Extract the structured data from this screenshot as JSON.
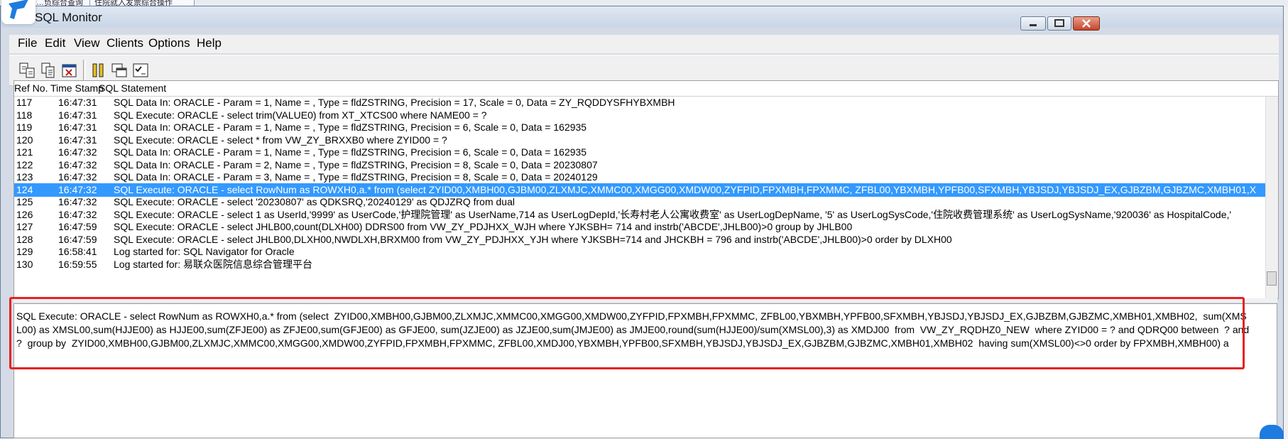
{
  "background_tabs": [
    "…负综合查询",
    "住院就入发票综合操作"
  ],
  "window": {
    "title": "SQL Monitor",
    "accent_color": "#3399ff",
    "highlight_color": "#e62222"
  },
  "menu": [
    {
      "label": "File"
    },
    {
      "label": "Edit"
    },
    {
      "label": "View"
    },
    {
      "label": "Clients"
    },
    {
      "label": "Options"
    },
    {
      "label": "Help"
    }
  ],
  "toolbar": {
    "buttons": [
      "save-log-icon",
      "copy-icon",
      "clear-icon",
      "pause-icon",
      "window-icon",
      "checklist-icon"
    ]
  },
  "list": {
    "columns": [
      "Ref No.",
      "Time Stamp",
      "SQL Statement"
    ],
    "selected_ref": "124",
    "rows": [
      {
        "ref": "117",
        "time": "16:47:31",
        "sql": "SQL Data In: ORACLE - Param = 1, Name = , Type = fldZSTRING, Precision = 17, Scale = 0, Data = ZY_RQDDYSFHYBXMBH"
      },
      {
        "ref": "118",
        "time": "16:47:31",
        "sql": "SQL Execute: ORACLE - select trim(VALUE0) from XT_XTCS00 where NAME00 = ?"
      },
      {
        "ref": "119",
        "time": "16:47:31",
        "sql": "SQL Data In: ORACLE - Param = 1, Name = , Type = fldZSTRING, Precision = 6, Scale = 0, Data = 162935"
      },
      {
        "ref": "120",
        "time": "16:47:31",
        "sql": "SQL Execute: ORACLE - select * from VW_ZY_BRXXB0 where ZYID00 = ?"
      },
      {
        "ref": "121",
        "time": "16:47:32",
        "sql": "SQL Data In: ORACLE - Param = 1, Name = , Type = fldZSTRING, Precision = 6, Scale = 0, Data = 162935"
      },
      {
        "ref": "122",
        "time": "16:47:32",
        "sql": "SQL Data In: ORACLE - Param = 2, Name = , Type = fldZSTRING, Precision = 8, Scale = 0, Data = 20230807"
      },
      {
        "ref": "123",
        "time": "16:47:32",
        "sql": "SQL Data In: ORACLE - Param = 3, Name = , Type = fldZSTRING, Precision = 8, Scale = 0, Data = 20240129"
      },
      {
        "ref": "124",
        "time": "16:47:32",
        "sql": "SQL Execute: ORACLE - select RowNum as ROWXH0,a.* from (select  ZYID00,XMBH00,GJBM00,ZLXMJC,XMMC00,XMGG00,XMDW00,ZYFPID,FPXMBH,FPXMMC, ZFBL00,YBXMBH,YPFB00,SFXMBH,YBJSDJ,YBJSDJ_EX,GJBZBM,GJBZMC,XMBH01,X"
      },
      {
        "ref": "125",
        "time": "16:47:32",
        "sql": "SQL Execute: ORACLE - select '20230807' as QDKSRQ,'20240129' as QDJZRQ from dual"
      },
      {
        "ref": "126",
        "time": "16:47:32",
        "sql": "SQL Execute: ORACLE - select 1 as UserId,'9999' as UserCode,'护理院管理' as UserName,714 as UserLogDepId,'长寿村老人公寓收费室' as UserLogDepName, '5' as UserLogSysCode,'住院收费管理系统' as UserLogSysName,'920036' as HospitalCode,'"
      },
      {
        "ref": "127",
        "time": "16:47:59",
        "sql": "SQL Execute: ORACLE - select JHLB00,count(DLXH00) DDRS00 from VW_ZY_PDJHXX_WJH    where YJKSBH= 714 and instrb('ABCDE',JHLB00)>0 group by JHLB00"
      },
      {
        "ref": "128",
        "time": "16:47:59",
        "sql": "SQL Execute: ORACLE - select JHLB00,DLXH00,NWDLXH,BRXM00 from VW_ZY_PDJHXX_YJH    where YJKSBH=714 and JHCKBH = 796 and instrb('ABCDE',JHLB00)>0 order by DLXH00"
      },
      {
        "ref": "129",
        "time": "16:58:41",
        "sql": "Log started for: SQL Navigator for Oracle"
      },
      {
        "ref": "130",
        "time": "16:59:55",
        "sql": "Log started for: 易联众医院信息综合管理平台"
      }
    ]
  },
  "detail": {
    "text": "SQL Execute: ORACLE - select RowNum as ROWXH0,a.* from (select  ZYID00,XMBH00,GJBM00,ZLXMJC,XMMC00,XMGG00,XMDW00,ZYFPID,FPXMBH,FPXMMC, ZFBL00,YBXMBH,YPFB00,SFXMBH,YBJSDJ,YBJSDJ_EX,GJBZBM,GJBZMC,XMBH01,XMBH02,  sum(XMSL00) as XMSL00,sum(HJJE00) as HJJE00,sum(ZFJE00) as ZFJE00,sum(GFJE00) as GFJE00, sum(JZJE00) as JZJE00,sum(JMJE00) as JMJE00,round(sum(HJJE00)/sum(XMSL00),3) as XMDJ00  from  VW_ZY_RQDHZ0_NEW  where ZYID00 = ? and QDRQ00 between  ? and ?  group by  ZYID00,XMBH00,GJBM00,ZLXMJC,XMMC00,XMGG00,XMDW00,ZYFPID,FPXMBH,FPXMMC, ZFBL00,XMDJ00,YBXMBH,YPFB00,SFXMBH,YBJSDJ,YBJSDJ_EX,GJBZBM,GJBZMC,XMBH01,XMBH02  having sum(XMSL00)<>0 order by FPXMBH,XMBH00) a"
  }
}
